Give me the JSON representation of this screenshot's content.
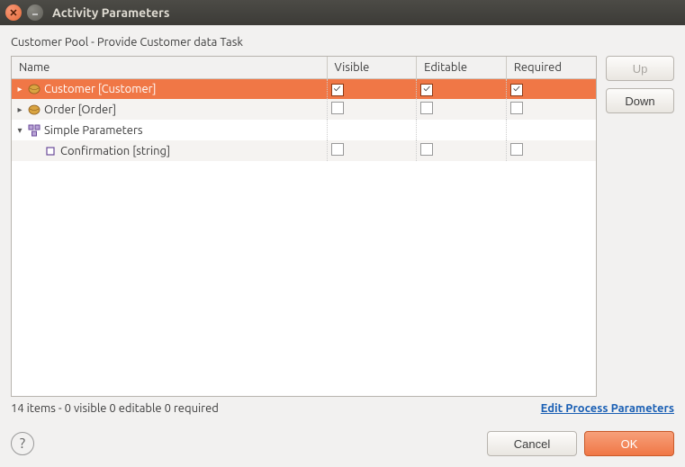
{
  "window": {
    "title": "Activity Parameters"
  },
  "subtitle": "Customer Pool  - Provide Customer data Task",
  "columns": {
    "name": "Name",
    "visible": "Visible",
    "editable": "Editable",
    "required": "Required"
  },
  "rows": [
    {
      "label": "Customer [Customer]",
      "visible": true,
      "editable": true,
      "required": true,
      "selected": true,
      "expander": "▸",
      "icon": "object"
    },
    {
      "label": "Order [Order]",
      "visible": false,
      "editable": false,
      "required": false,
      "selected": false,
      "expander": "▸",
      "icon": "object",
      "alt": true
    },
    {
      "label": "Simple Parameters",
      "visible": null,
      "editable": null,
      "required": null,
      "selected": false,
      "expander": "▾",
      "icon": "group"
    },
    {
      "label": "Confirmation [string]",
      "visible": false,
      "editable": false,
      "required": false,
      "selected": false,
      "expander": "",
      "icon": "leaf",
      "indent": 1,
      "alt": true
    }
  ],
  "buttons": {
    "up": "Up",
    "down": "Down",
    "cancel": "Cancel",
    "ok": "OK"
  },
  "status": "14 items - 0 visible  0 editable  0 required",
  "link": "Edit Process Parameters",
  "help": "?"
}
